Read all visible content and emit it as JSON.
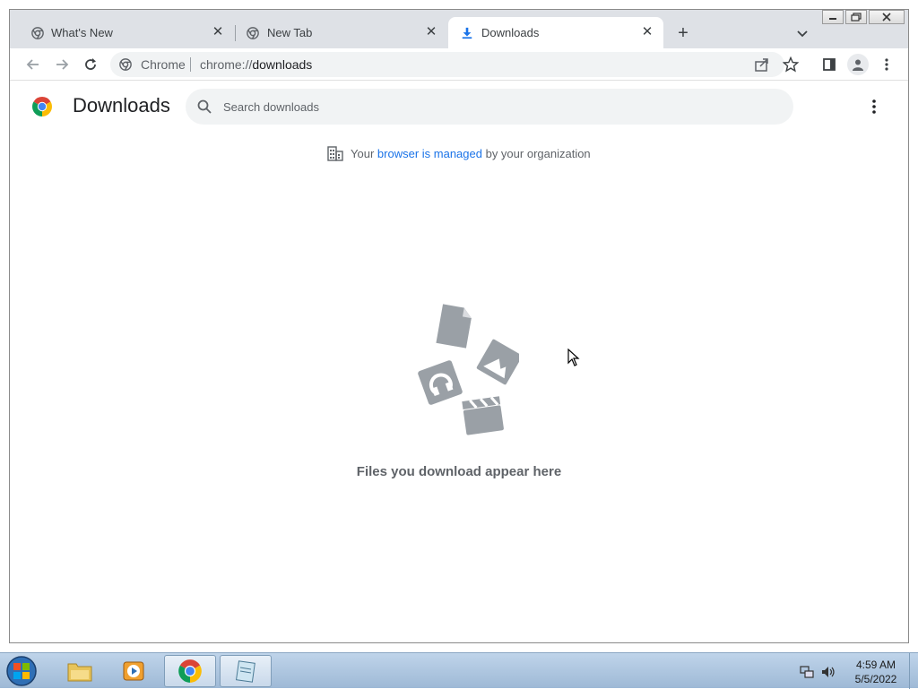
{
  "browser": {
    "tabs": [
      {
        "title": "What's New",
        "icon": "chrome-icon",
        "active": false
      },
      {
        "title": "New Tab",
        "icon": "chrome-icon",
        "active": false
      },
      {
        "title": "Downloads",
        "icon": "download-icon",
        "active": true
      }
    ],
    "new_tab_label": "+",
    "omnibox": {
      "chip": "Chrome",
      "url_scheme": "chrome://",
      "url_host": "downloads"
    }
  },
  "page": {
    "title": "Downloads",
    "search_placeholder": "Search downloads",
    "managed": {
      "prefix": "Your",
      "link": "browser is managed",
      "suffix": "by your organization"
    },
    "empty_message": "Files you download appear here"
  },
  "taskbar": {
    "items": [
      "start-orb",
      "file-explorer",
      "media-player",
      "chrome",
      "notepad"
    ],
    "active_item": "chrome",
    "clock_time": "4:59 AM",
    "clock_date": "5/5/2022"
  },
  "colors": {
    "tabstrip": "#dee1e6",
    "accent_link": "#1a73e8",
    "empty_art": "#9aa0a6",
    "taskbar": "#bfd4ea"
  }
}
